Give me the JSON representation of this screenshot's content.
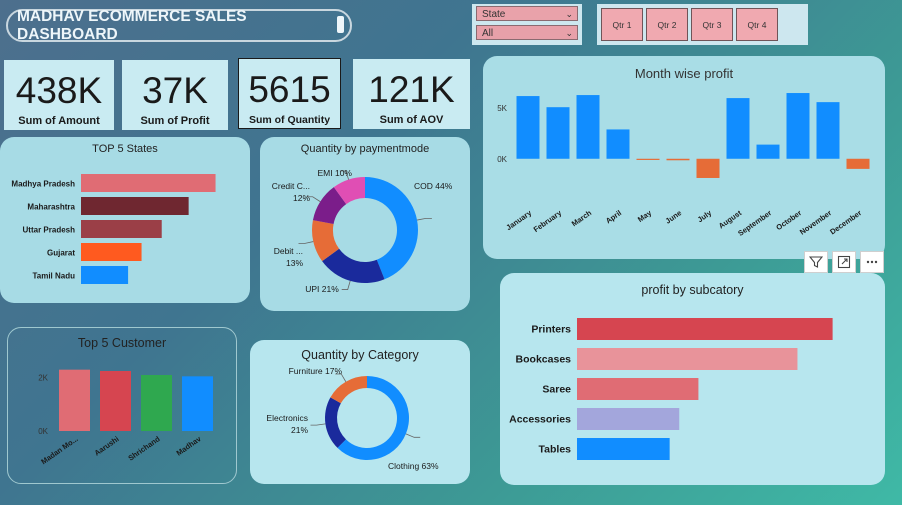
{
  "dashboard": {
    "title": "MADHAV ECOMMERCE SALES DASHBOARD"
  },
  "slicer": {
    "label": "State",
    "value": "All"
  },
  "quarters": [
    "Qtr 1",
    "Qtr 2",
    "Qtr 3",
    "Qtr 4"
  ],
  "kpis": [
    {
      "value": "438K",
      "label": "Sum of Amount"
    },
    {
      "value": "37K",
      "label": "Sum of Profit"
    },
    {
      "value": "5615",
      "label": "Sum of Quantity"
    },
    {
      "value": "121K",
      "label": "Sum of AOV"
    }
  ],
  "colors": {
    "blue": "#118dff",
    "orange": "#e66c37",
    "red": "#d64550",
    "pink": "#e8939a",
    "salmon": "#e06c74",
    "lavender": "#a3a6dc",
    "green": "#2fa84f",
    "navy": "#1a2a9c",
    "purple": "#7b1d8a",
    "magenta": "#e04eb4"
  },
  "chart_data": [
    {
      "id": "top5_states",
      "type": "bar",
      "orientation": "horizontal",
      "title": "TOP 5 States",
      "categories": [
        "Madhya Pradesh",
        "Maharashtra",
        "Uttar Pradesh",
        "Gujarat",
        "Tamil Nadu"
      ],
      "values": [
        105000,
        101000,
        97000,
        94000,
        92000
      ],
      "xlim": [
        85000,
        107000
      ],
      "colors": [
        "#e06c74",
        "#6f2730",
        "#9b3f47",
        "#ff5a1f",
        "#118dff"
      ]
    },
    {
      "id": "qty_by_paymentmode",
      "type": "pie",
      "donut": true,
      "title": "Quantity by paymentmode",
      "labels": [
        "COD",
        "UPI",
        "Debit ...",
        "Credit C...",
        "EMI"
      ],
      "values": [
        44,
        21,
        13,
        12,
        10
      ],
      "label_texts": [
        "COD 44%",
        "UPI 21%",
        "Debit ...",
        "Credit C...",
        "EMI 10%"
      ],
      "sub_labels": [
        "",
        "",
        "13%",
        "12%",
        ""
      ],
      "colors": [
        "#118dff",
        "#1a2a9c",
        "#e66c37",
        "#7b1d8a",
        "#e04eb4"
      ]
    },
    {
      "id": "month_wise_profit",
      "type": "bar",
      "title": "Month wise profit",
      "categories": [
        "January",
        "February",
        "March",
        "April",
        "May",
        "June",
        "July",
        "August",
        "September",
        "October",
        "November",
        "December"
      ],
      "values": [
        6200,
        5100,
        6300,
        2900,
        -100,
        -150,
        -1900,
        6000,
        1400,
        6500,
        5600,
        -1000
      ],
      "yticks": [
        {
          "value": 0,
          "label": "0K"
        },
        {
          "value": 5000,
          "label": "5K"
        }
      ],
      "ylim": [
        -2100,
        6800
      ],
      "positive_color": "#118dff",
      "negative_color": "#e66c37"
    },
    {
      "id": "top5_customer",
      "type": "bar",
      "title": "Top 5 Customer",
      "categories": [
        "Madan Mo...",
        "Aarushi",
        "Shrichand",
        "Madhav"
      ],
      "values": [
        2300,
        2250,
        2100,
        2050
      ],
      "yticks": [
        {
          "value": 0,
          "label": "0K"
        },
        {
          "value": 2000,
          "label": "2K"
        }
      ],
      "ylim": [
        0,
        2700
      ],
      "colors": [
        "#e06c74",
        "#d64550",
        "#2fa84f",
        "#118dff"
      ]
    },
    {
      "id": "qty_by_category",
      "type": "pie",
      "donut": true,
      "title": "Quantity by Category",
      "labels": [
        "Clothing",
        "Electronics",
        "Furniture"
      ],
      "values": [
        63,
        21,
        17
      ],
      "label_texts": [
        "Clothing 63%",
        "Electronics",
        "Furniture 17%"
      ],
      "sub_labels": [
        "",
        "21%",
        ""
      ],
      "colors": [
        "#118dff",
        "#1a2a9c",
        "#e66c37"
      ]
    },
    {
      "id": "profit_by_subcategory",
      "type": "bar",
      "orientation": "horizontal",
      "title": "profit by subcatory",
      "categories": [
        "Printers",
        "Bookcases",
        "Saree",
        "Accessories",
        "Tables"
      ],
      "values": [
        8000,
        6900,
        3800,
        3200,
        2900
      ],
      "xlim": [
        0,
        8200
      ],
      "colors": [
        "#d64550",
        "#e8939a",
        "#e06c74",
        "#a3a6dc",
        "#118dff"
      ]
    }
  ]
}
